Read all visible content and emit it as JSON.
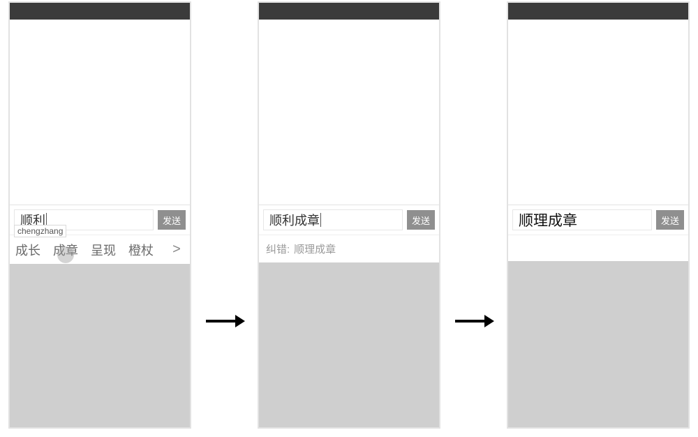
{
  "send_label": "发送",
  "screens": [
    {
      "input_text": "顺利",
      "pinyin_overlay": "chengzhang",
      "candidates": [
        "成长",
        "成章",
        "呈现",
        "橙杖"
      ],
      "more_glyph": ">"
    },
    {
      "input_text": "顺利成章",
      "correction_prefix": "纠错:",
      "correction_text": "顺理成章"
    },
    {
      "input_text": "顺理成章"
    }
  ]
}
